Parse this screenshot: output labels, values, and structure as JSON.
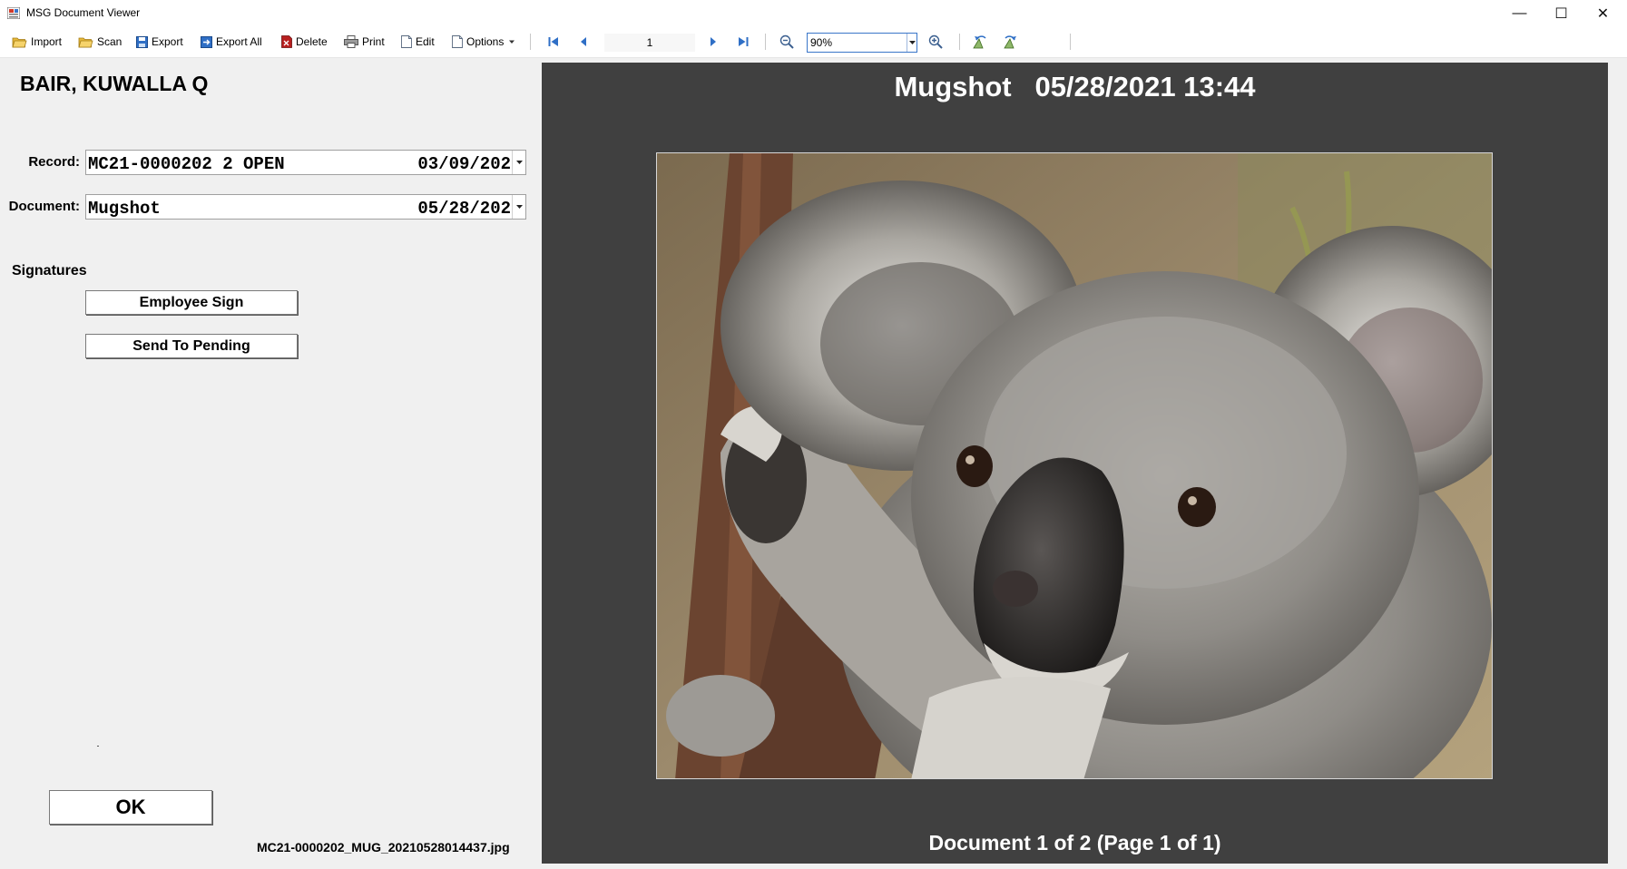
{
  "window": {
    "title": "MSG Document Viewer",
    "minimize_glyph": "—",
    "maximize_glyph": "☐",
    "close_glyph": "✕"
  },
  "toolbar": {
    "import_label": "Import",
    "scan_label": "Scan",
    "export_label": "Export",
    "export_all_label": "Export All",
    "delete_label": "Delete",
    "print_label": "Print",
    "edit_label": "Edit",
    "options_label": "Options",
    "page_number": "1",
    "zoom_value": "90%"
  },
  "subject": {
    "name": "BAIR, KUWALLA Q"
  },
  "record": {
    "label": "Record:",
    "value": "MC21-0000202 2 OPEN",
    "date": "03/09/202"
  },
  "document": {
    "label": "Document:",
    "value": "Mugshot",
    "date": "05/28/202"
  },
  "signatures": {
    "title": "Signatures",
    "employee_sign_label": "Employee Sign",
    "send_to_pending_label": "Send To Pending"
  },
  "ok_label": "OK",
  "filename": "MC21-0000202_MUG_20210528014437.jpg",
  "viewer": {
    "title": "Mugshot   05/28/2021 13:44",
    "footer": "Document 1 of 2 (Page 1 of 1)",
    "photo_subject": "koala"
  },
  "colors": {
    "viewer_bg": "#404040",
    "accent": "#3a76c9",
    "folder_icon": "#e8b93a",
    "nav_icon": "#2f6fc6",
    "delete_icon": "#b81f1f"
  }
}
